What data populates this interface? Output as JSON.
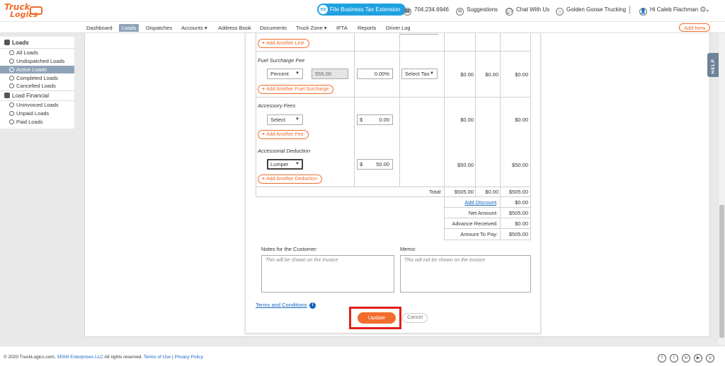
{
  "header": {
    "logo_line1": "Truck",
    "logo_line2": "Logics",
    "tax_pill_label": "File Business Tax Extension",
    "phone": "704.234.6946",
    "suggestions": "Suggestions",
    "chat": "Chat With Us",
    "company": "Golden Goose Trucking",
    "greeting": "Hi Caleb Flachman"
  },
  "nav": {
    "items": [
      "Dashboard",
      "Loads",
      "Dispatches",
      "Accounts ▾",
      "Address Book",
      "Documents",
      "Truck Zone ▾",
      "IFTA",
      "Reports",
      "Driver Log"
    ],
    "active": "Loads",
    "add_new": "Add New"
  },
  "sidebar": {
    "loads_heading": "Loads",
    "loads_items": [
      "All Loads",
      "Undispatched Loads",
      "Active Loads",
      "Completed Loads",
      "Cancelled Loads"
    ],
    "active_item": "Active Loads",
    "financial_heading": "Load Financial",
    "financial_items": [
      "Uninvoiced Loads",
      "Unpaid Loads",
      "Paid Loads"
    ]
  },
  "form": {
    "add_line": "Add Another Line",
    "fuel": {
      "label": "Fuel Surcharge Fee",
      "type_selected": "Percent",
      "base_value": "555.00",
      "percent_value": "0.00",
      "percent_sign": "%",
      "tax_selected": "Select Tax",
      "amt1": "$0.00",
      "amt2": "$0.00",
      "amt3": "$0.00",
      "add_button": "Add Another Fuel Surcharge"
    },
    "accessory": {
      "label": "Accessory Fees",
      "type_selected": "Select",
      "currency": "$",
      "value": "0.00",
      "amt1": "$0.00",
      "amt3": "$0.00",
      "add_button": "Add Another Fee"
    },
    "deduction": {
      "label": "Accessorial Deduction",
      "type_selected": "Lumper",
      "currency": "$",
      "value": "50.00",
      "amt1": "$50.00",
      "amt3": "$50.00",
      "add_button": "Add Another Deduction"
    },
    "totals": {
      "total_label": "Total:",
      "total_1": "$505.00",
      "total_2": "$0.00",
      "total_3": "$505.00",
      "discount_label": "Add Discount",
      "discount_colon": ":",
      "discount_value": "$0.00",
      "net_label": "Net Amount:",
      "net_value": "$505.00",
      "advance_label": "Advance Received:",
      "advance_value": "$0.00",
      "pay_label": "Amount To Pay:",
      "pay_value": "$505.00"
    },
    "notes_label": "Notes for the Customer:",
    "notes_placeholder": "This will be shown on the Invoice",
    "memo_label": "Memo:",
    "memo_placeholder": "This will not be shown on the Invoice",
    "terms_link": "Terms and Conditions",
    "update_button": "Update",
    "cancel_button": "Cancel"
  },
  "help_tab": "HELP",
  "footer": {
    "copyright": "© 2020 TruckLogics.com, ",
    "company_link": "SPAN Enterprises LLC",
    "rights": " All rights reserved. ",
    "terms": "Terms of Use",
    "divider": " | ",
    "privacy": "Privacy Policy",
    "social": [
      "f",
      "t",
      "in",
      "▶",
      "p"
    ]
  },
  "colors": {
    "brand_orange": "#f26c2c",
    "nav_active": "#8fa3b8",
    "link_blue": "#1565c0",
    "highlight_red": "#e0201c"
  }
}
